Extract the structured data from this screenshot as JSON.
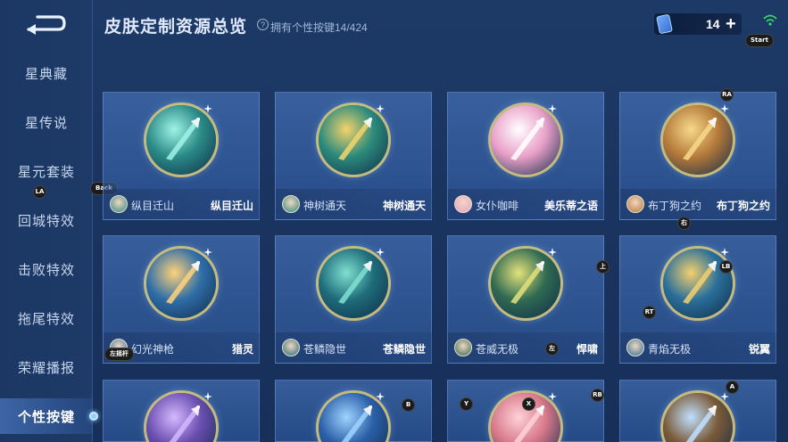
{
  "header": {
    "title": "皮肤定制资源总览",
    "subtitle": "拥有个性按键14/424",
    "currency_value": "14",
    "start_hint": "Start"
  },
  "sidebar": {
    "items": [
      {
        "label": "星典藏"
      },
      {
        "label": "星传说"
      },
      {
        "label": "星元套装"
      },
      {
        "label": "回城特效"
      },
      {
        "label": "击败特效"
      },
      {
        "label": "拖尾特效"
      },
      {
        "label": "荣耀播报"
      },
      {
        "label": "个性按键",
        "active": true
      }
    ],
    "back_hint": "Back",
    "la_hint": "LA"
  },
  "hints": {
    "ra": "RA",
    "lb": "LB",
    "rt": "RT",
    "top": "上",
    "right": "右",
    "left": "左",
    "left_stick": "左摇杆",
    "b": "B",
    "y": "Y",
    "x": "X",
    "rb": "RB",
    "a": "A"
  },
  "cards": [
    {
      "hero": "纵目迁山",
      "skin": "纵目迁山",
      "ring": "#2a8a86",
      "accent": "#9ff3e6"
    },
    {
      "hero": "神树通天",
      "skin": "神树通天",
      "ring": "#2b8a7c",
      "accent": "#f3d36b"
    },
    {
      "hero": "女仆咖啡",
      "skin": "美乐蒂之语",
      "ring": "#e9a0c8",
      "accent": "#ffffff"
    },
    {
      "hero": "布丁狗之约",
      "skin": "布丁狗之约",
      "ring": "#b57a3a",
      "accent": "#f6d98a"
    },
    {
      "hero": "幻光神枪",
      "skin": "猎灵",
      "ring": "#2f6ea8",
      "accent": "#ffd27a"
    },
    {
      "hero": "苍鳞隐世",
      "skin": "苍鳞隐世",
      "ring": "#1e6c7a",
      "accent": "#7fe0d0"
    },
    {
      "hero": "苍威无极",
      "skin": "悍啸",
      "ring": "#2f6a52",
      "accent": "#e4e27a"
    },
    {
      "hero": "青焰无极",
      "skin": "锐翼",
      "ring": "#2a6f9a",
      "accent": "#f5d06f"
    },
    {
      "hero": "",
      "skin": "",
      "ring": "#6a4db0",
      "accent": "#d4b8ff"
    },
    {
      "hero": "",
      "skin": "",
      "ring": "#2a5fa8",
      "accent": "#9fd3ff"
    },
    {
      "hero": "",
      "skin": "",
      "ring": "#d7788a",
      "accent": "#ffd2d8"
    },
    {
      "hero": "",
      "skin": "",
      "ring": "#7a5a38",
      "accent": "#bfe0ff"
    }
  ],
  "colors": {
    "background": "#1a3460",
    "card": "#4a7bc0",
    "active_item": "#5a8cdc"
  }
}
